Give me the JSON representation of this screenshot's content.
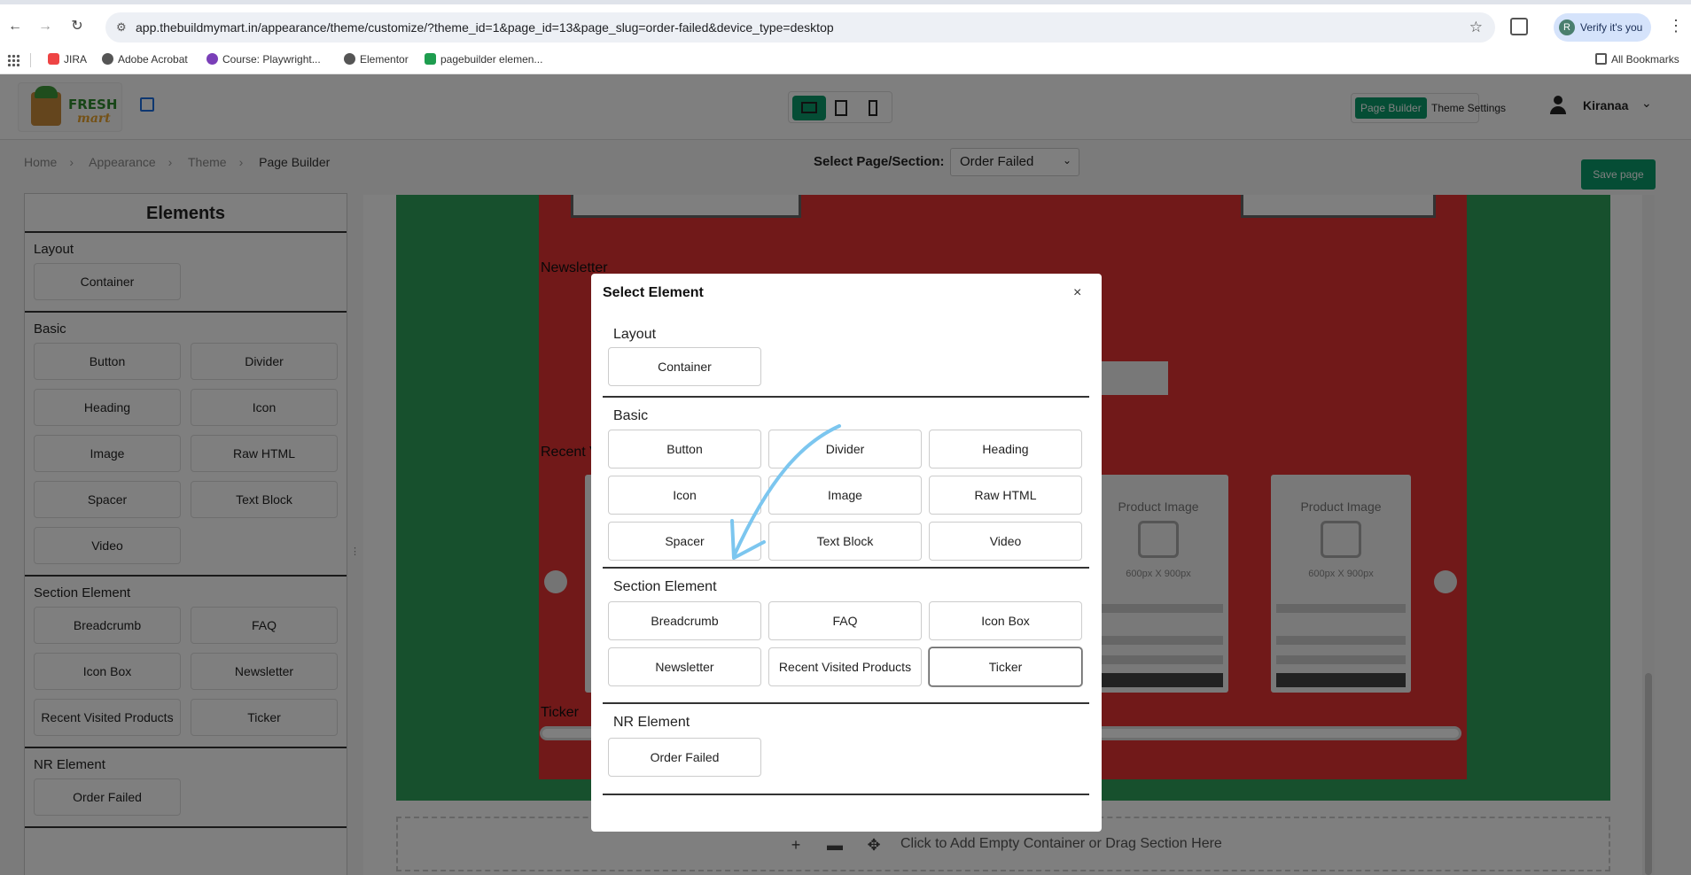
{
  "browser": {
    "url": "app.thebuildmymart.in/appearance/theme/customize/?theme_id=1&page_id=13&page_slug=order-failed&device_type=desktop",
    "profile_label": "Verify it's you",
    "profile_initial": "R",
    "bookmarks": [
      "JIRA",
      "Adobe Acrobat",
      "Course: Playwright...",
      "Elementor",
      "pagebuilder elemen..."
    ],
    "all_bookmarks_label": "All Bookmarks"
  },
  "app_header": {
    "logo_line1": "FRESH",
    "logo_line2": "mart",
    "tabs": [
      "Page Builder",
      "Theme Settings"
    ],
    "username": "Kiranaa"
  },
  "subbar": {
    "breadcrumb": [
      "Home",
      "Appearance",
      "Theme",
      "Page Builder"
    ],
    "select_label": "Select Page/Section:",
    "select_value": "Order Failed",
    "save_label": "Save page"
  },
  "elements_panel": {
    "title": "Elements",
    "layout": {
      "label": "Layout",
      "items": [
        "Container"
      ]
    },
    "basic": {
      "label": "Basic",
      "items": [
        "Button",
        "Divider",
        "Heading",
        "Icon",
        "Image",
        "Raw HTML",
        "Spacer",
        "Text Block",
        "Video"
      ]
    },
    "section": {
      "label": "Section Element",
      "items": [
        "Breadcrumb",
        "FAQ",
        "Icon Box",
        "Newsletter",
        "Recent Visited Products",
        "Ticker"
      ]
    },
    "nr": {
      "label": "NR Element",
      "items": [
        "Order Failed"
      ]
    }
  },
  "canvas": {
    "newsletter_label": "Newsletter",
    "recent_label": "Recent V",
    "ticker_label": "Ticker",
    "product_title": "Product Image",
    "product_size": "600px X 900px",
    "add_message": "Click to Add Empty Container or Drag Section Here"
  },
  "modal": {
    "title": "Select Element",
    "close": "×",
    "layout": {
      "label": "Layout",
      "items": [
        "Container"
      ]
    },
    "basic": {
      "label": "Basic",
      "items": [
        "Button",
        "Divider",
        "Heading",
        "Icon",
        "Image",
        "Raw HTML",
        "Spacer",
        "Text Block",
        "Video"
      ]
    },
    "section": {
      "label": "Section Element",
      "items": [
        "Breadcrumb",
        "FAQ",
        "Icon Box",
        "Newsletter",
        "Recent Visited Products",
        "Ticker"
      ]
    },
    "nr": {
      "label": "NR Element",
      "items": [
        "Order Failed"
      ]
    }
  },
  "colors": {
    "accent_green": "#0a9a6a",
    "canvas_green": "#2ea05a",
    "canvas_red": "#e33232",
    "annotation_arrow": "#7cc6ef"
  }
}
